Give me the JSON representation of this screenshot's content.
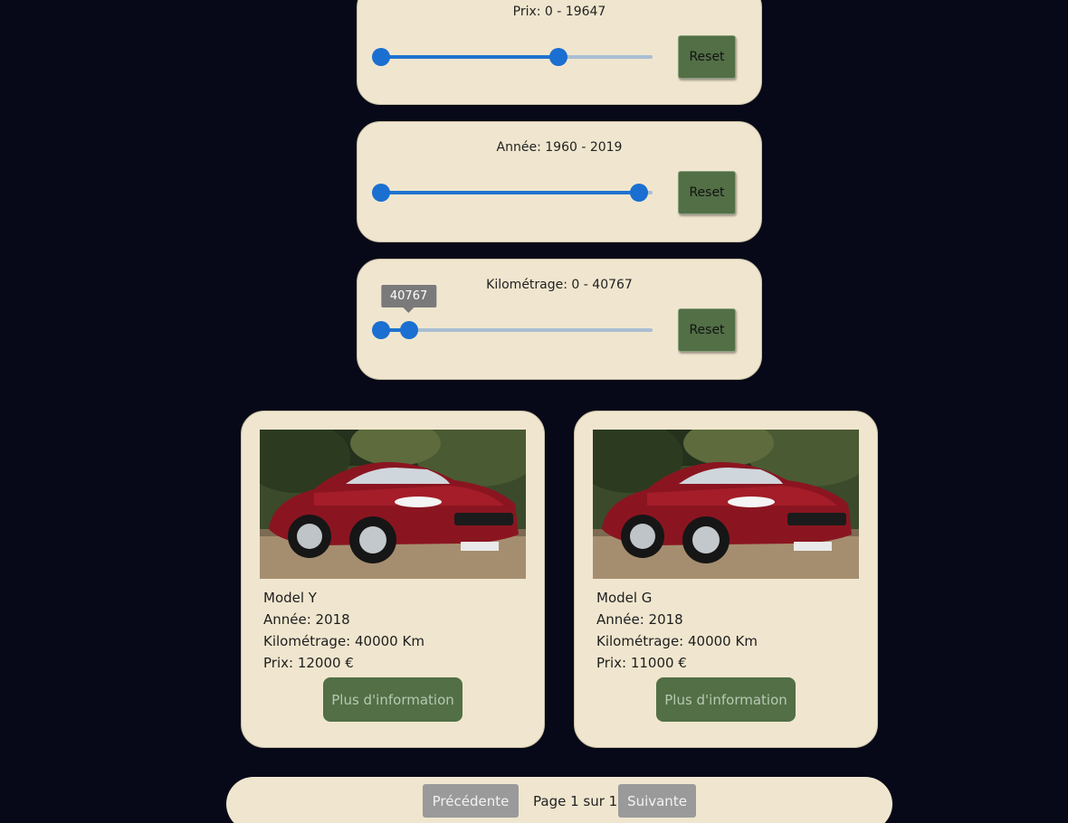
{
  "filters": [
    {
      "title": "Prix: 0 - 19647",
      "range": [
        0,
        30000
      ],
      "value": [
        0,
        19647
      ],
      "reset_label": "Reset",
      "tooltip": ""
    },
    {
      "title": "Année: 1960 - 2019",
      "range": [
        1960,
        2022
      ],
      "value": [
        1960,
        2019
      ],
      "reset_label": "Reset",
      "tooltip": ""
    },
    {
      "title": "Kilométrage: 0 - 40767",
      "range": [
        0,
        400000
      ],
      "value": [
        0,
        40767
      ],
      "reset_label": "Reset",
      "tooltip": "40767"
    }
  ],
  "cars": [
    {
      "model": "Model Y",
      "year": "Année: 2018",
      "mileage": "Kilométrage: 40000 Km",
      "price": "Prix: 12000 €",
      "button": "Plus d'information"
    },
    {
      "model": "Model G",
      "year": "Année: 2018",
      "mileage": "Kilométrage: 40000 Km",
      "price": "Prix: 11000 €",
      "button": "Plus d'information"
    }
  ],
  "pagination": {
    "prev": "Précédente",
    "label": "Page 1 sur 1",
    "next": "Suivante"
  },
  "colors": {
    "background": "#070918",
    "card": "#f0e6cf",
    "accent_green": "#526f46",
    "slider_blue": "#1a6fd0"
  }
}
